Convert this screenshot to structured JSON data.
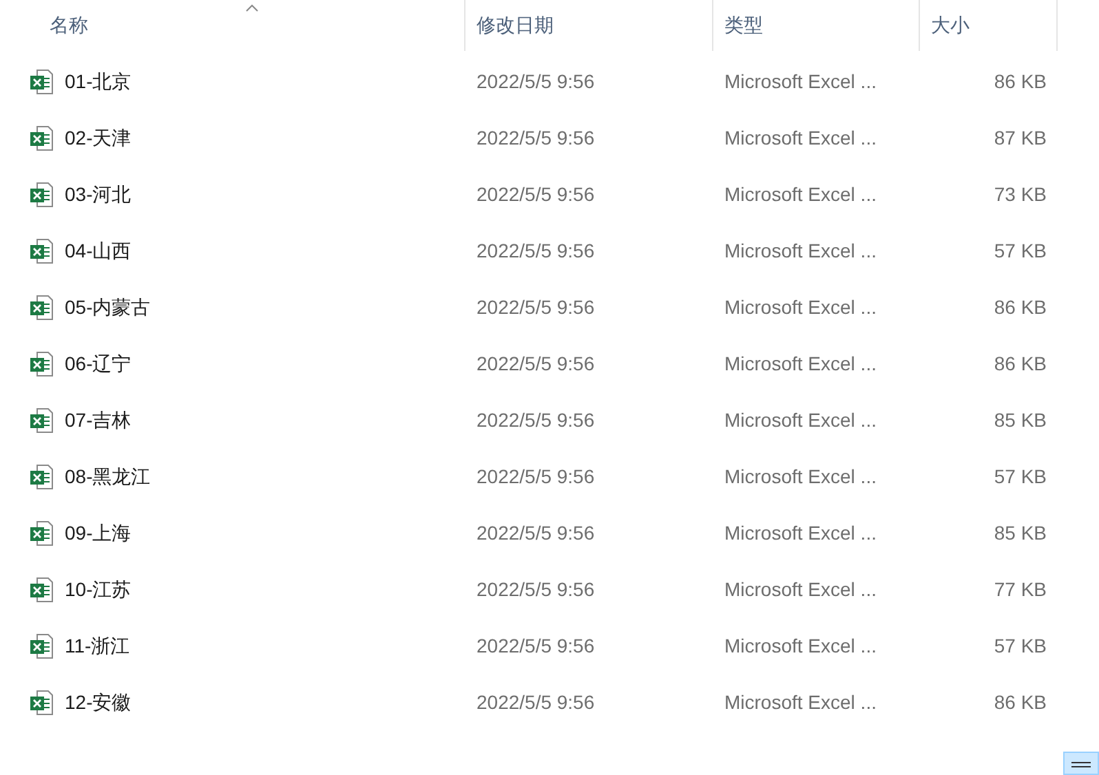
{
  "columns": [
    {
      "label": "名称",
      "sorted": true
    },
    {
      "label": "修改日期",
      "sorted": false
    },
    {
      "label": "类型",
      "sorted": false
    },
    {
      "label": "大小",
      "sorted": false
    }
  ],
  "files": [
    {
      "name": "01-北京",
      "modified": "2022/5/5 9:56",
      "type": "Microsoft Excel ...",
      "size": "86 KB"
    },
    {
      "name": "02-天津",
      "modified": "2022/5/5 9:56",
      "type": "Microsoft Excel ...",
      "size": "87 KB"
    },
    {
      "name": "03-河北",
      "modified": "2022/5/5 9:56",
      "type": "Microsoft Excel ...",
      "size": "73 KB"
    },
    {
      "name": "04-山西",
      "modified": "2022/5/5 9:56",
      "type": "Microsoft Excel ...",
      "size": "57 KB"
    },
    {
      "name": "05-内蒙古",
      "modified": "2022/5/5 9:56",
      "type": "Microsoft Excel ...",
      "size": "86 KB"
    },
    {
      "name": "06-辽宁",
      "modified": "2022/5/5 9:56",
      "type": "Microsoft Excel ...",
      "size": "86 KB"
    },
    {
      "name": "07-吉林",
      "modified": "2022/5/5 9:56",
      "type": "Microsoft Excel ...",
      "size": "85 KB"
    },
    {
      "name": "08-黑龙江",
      "modified": "2022/5/5 9:56",
      "type": "Microsoft Excel ...",
      "size": "57 KB"
    },
    {
      "name": "09-上海",
      "modified": "2022/5/5 9:56",
      "type": "Microsoft Excel ...",
      "size": "85 KB"
    },
    {
      "name": "10-江苏",
      "modified": "2022/5/5 9:56",
      "type": "Microsoft Excel ...",
      "size": "77 KB"
    },
    {
      "name": "11-浙江",
      "modified": "2022/5/5 9:56",
      "type": "Microsoft Excel ...",
      "size": "57 KB"
    },
    {
      "name": "12-安徽",
      "modified": "2022/5/5 9:56",
      "type": "Microsoft Excel ...",
      "size": "86 KB"
    }
  ]
}
